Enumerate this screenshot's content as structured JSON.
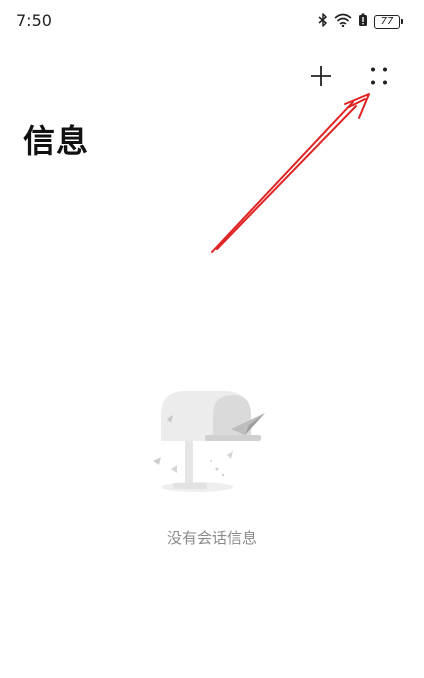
{
  "status_bar": {
    "time": "7:50",
    "battery_level": "77",
    "icons": [
      "bluetooth-icon",
      "wifi-icon",
      "battery-saver-icon",
      "battery-icon"
    ]
  },
  "toolbar": {
    "add_icon": "plus-icon",
    "more_icon": "more-dots-icon"
  },
  "page": {
    "title": "信息"
  },
  "empty_state": {
    "illustration": "mailbox-illustration",
    "message": "没有会话信息"
  },
  "colors": {
    "annotation_arrow": "#e02424",
    "empty_text": "#8a8a8a"
  }
}
